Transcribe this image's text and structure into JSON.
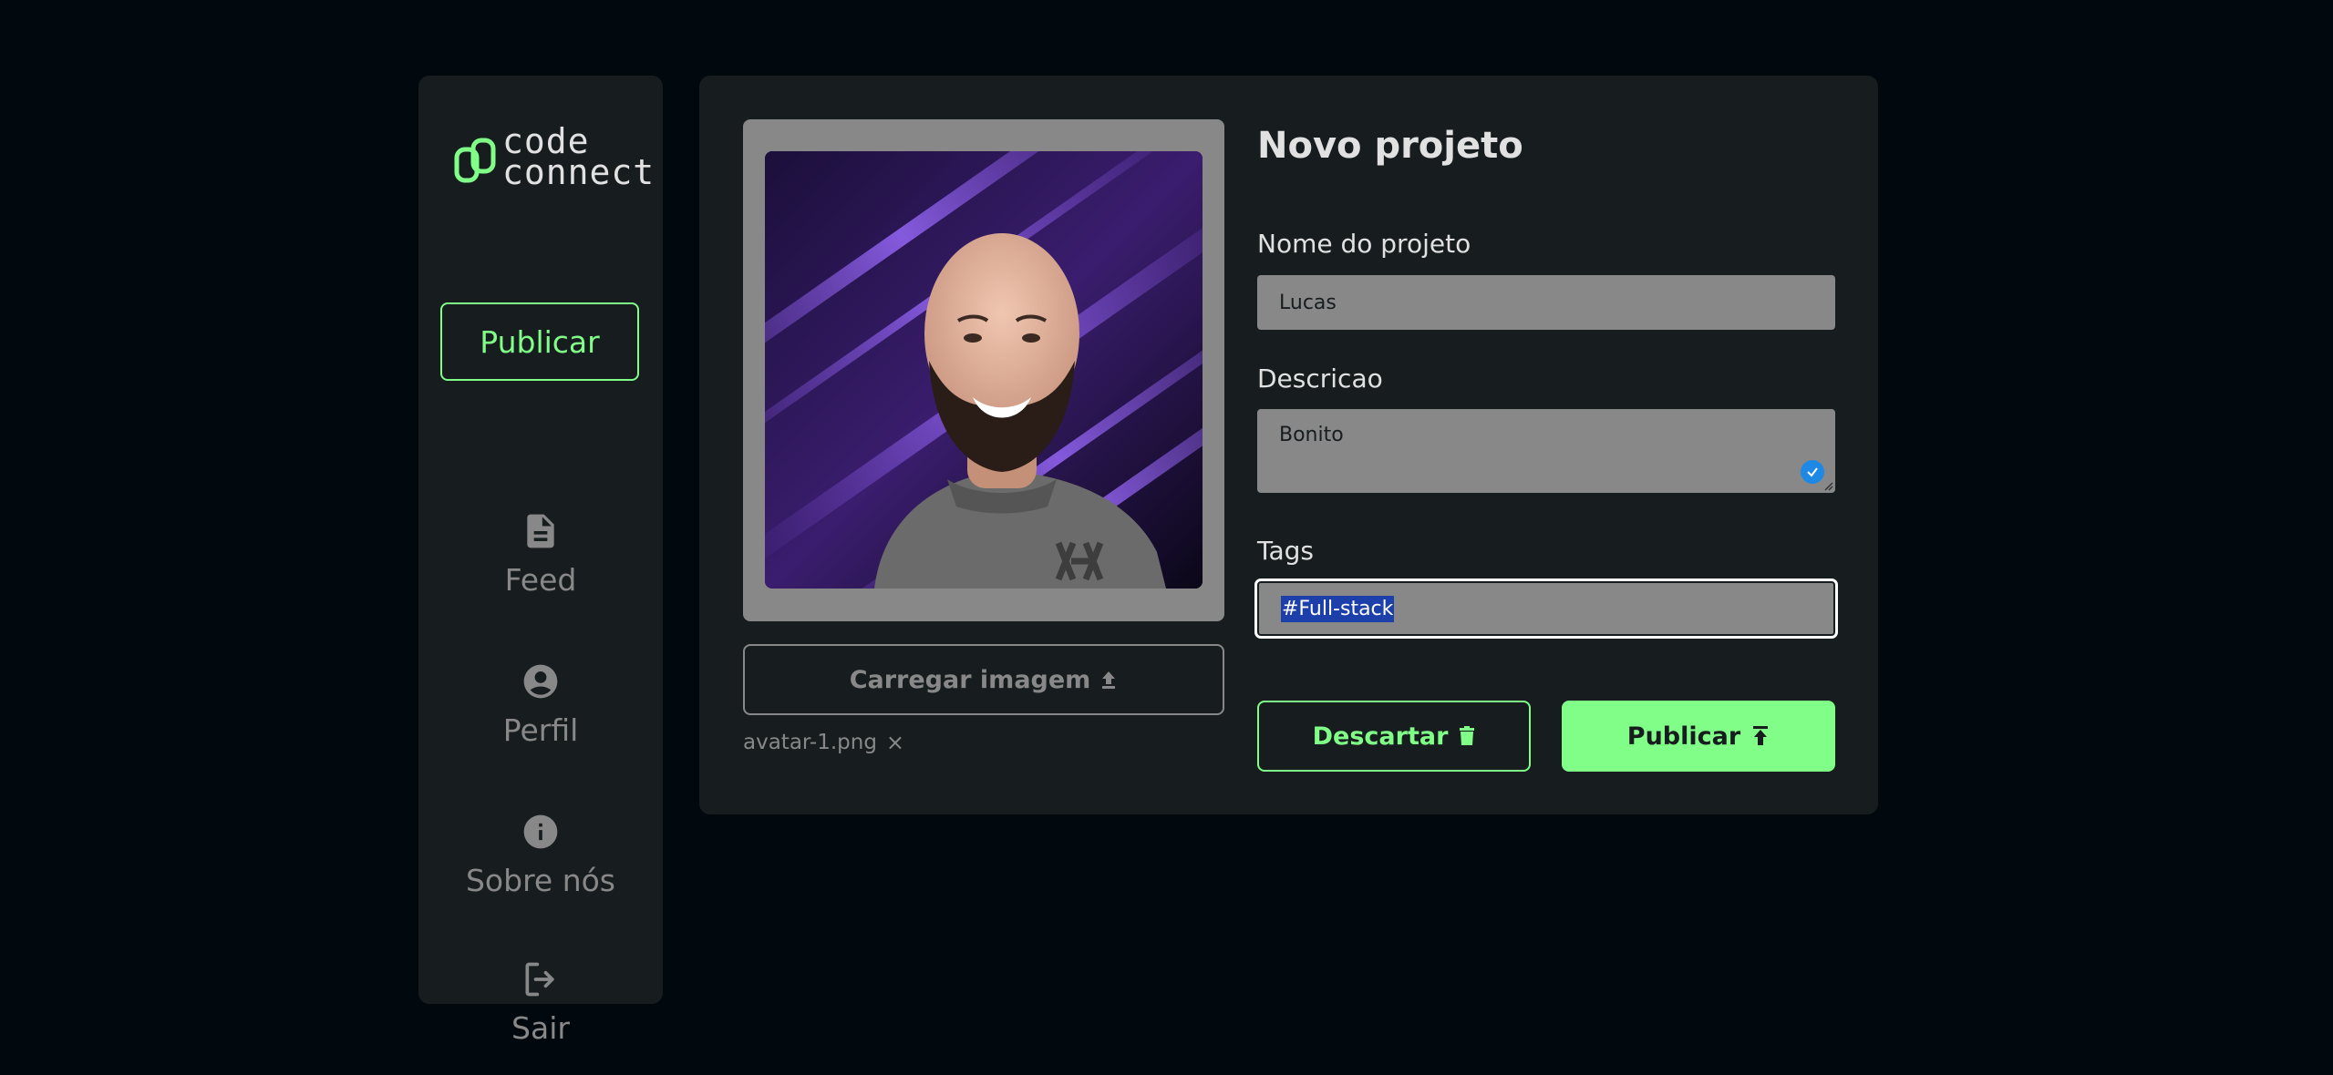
{
  "sidebar": {
    "logo": {
      "line1": "code",
      "line2": "connect"
    },
    "publish_label": "Publicar",
    "items": [
      {
        "label": "Feed",
        "icon": "document-icon"
      },
      {
        "label": "Perfil",
        "icon": "account-circle-icon"
      },
      {
        "label": "Sobre nós",
        "icon": "info-icon"
      },
      {
        "label": "Sair",
        "icon": "logout-icon"
      }
    ]
  },
  "form": {
    "title": "Novo projeto",
    "name_label": "Nome do projeto",
    "name_value": "Lucas",
    "description_label": "Descricao",
    "description_value": "Bonito",
    "tags_label": "Tags",
    "tags_value": "#Full-stack",
    "upload_label": "Carregar imagem",
    "file_name": "avatar-1.png",
    "file_remove": "×",
    "discard_label": "Descartar",
    "publish_label": "Publicar"
  },
  "colors": {
    "background": "#01080E",
    "panel": "#171D1F",
    "accent": "#81FE88",
    "muted": "#888888",
    "text": "#E1E1E1"
  }
}
